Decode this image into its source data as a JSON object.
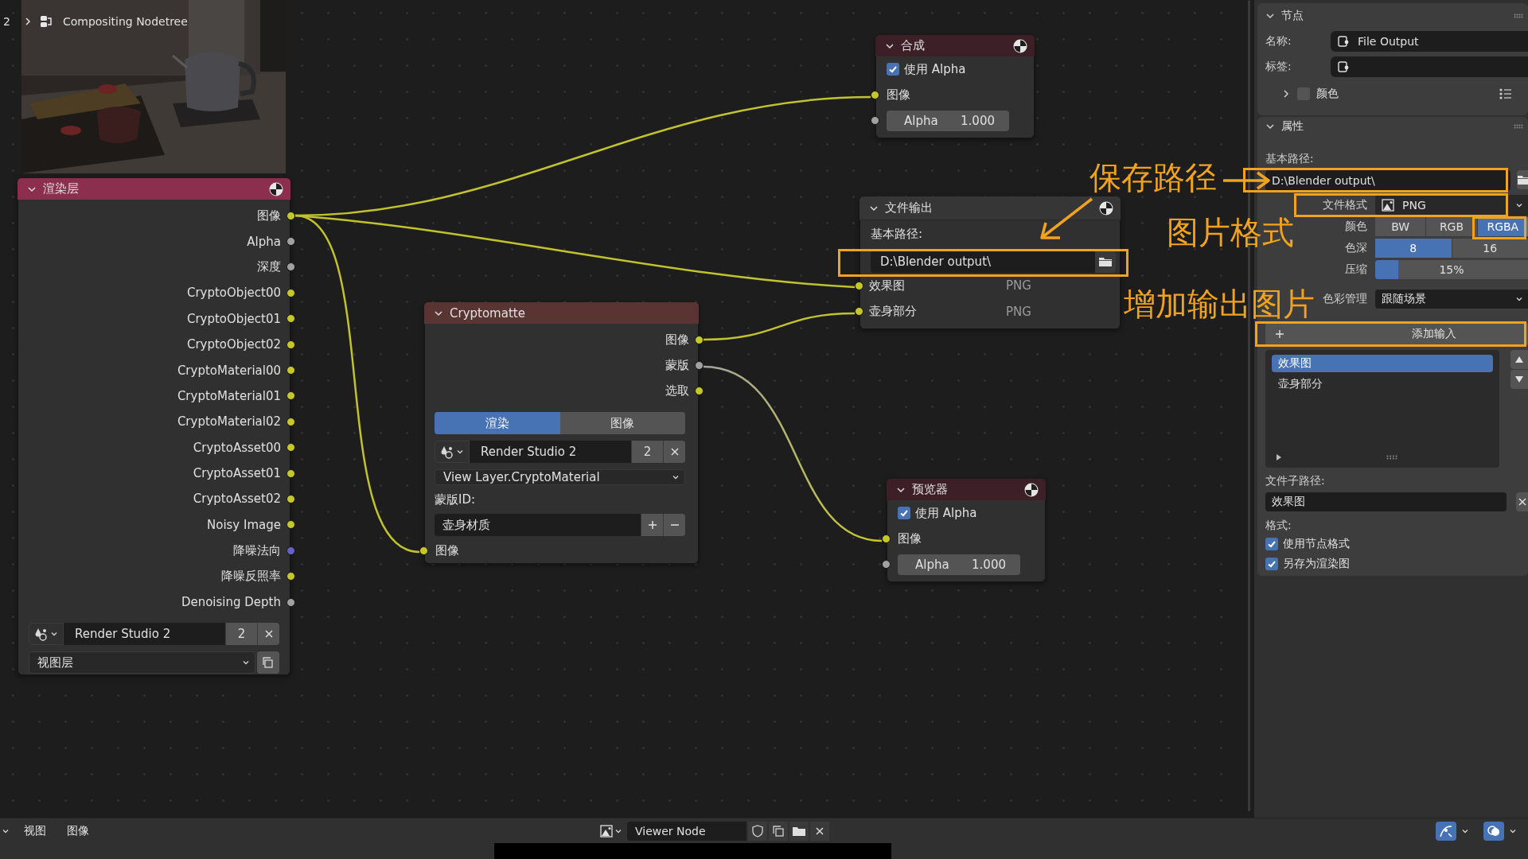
{
  "breadcrumb": {
    "index": "2",
    "title": "Compositing Nodetree"
  },
  "render_layers_node": {
    "title": "渲染层",
    "outputs": [
      {
        "label": "图像",
        "color": "#c7c729"
      },
      {
        "label": "Alpha",
        "color": "#a1a1a1"
      },
      {
        "label": "深度",
        "color": "#a1a1a1"
      },
      {
        "label": "CryptoObject00",
        "color": "#c7c729"
      },
      {
        "label": "CryptoObject01",
        "color": "#c7c729"
      },
      {
        "label": "CryptoObject02",
        "color": "#c7c729"
      },
      {
        "label": "CryptoMaterial00",
        "color": "#c7c729"
      },
      {
        "label": "CryptoMaterial01",
        "color": "#c7c729"
      },
      {
        "label": "CryptoMaterial02",
        "color": "#c7c729"
      },
      {
        "label": "CryptoAsset00",
        "color": "#c7c729"
      },
      {
        "label": "CryptoAsset01",
        "color": "#c7c729"
      },
      {
        "label": "CryptoAsset02",
        "color": "#c7c729"
      },
      {
        "label": "Noisy Image",
        "color": "#c7c729"
      },
      {
        "label": "降噪法向",
        "color": "#6363c7"
      },
      {
        "label": "降噪反照率",
        "color": "#c7c729"
      },
      {
        "label": "Denoising Depth",
        "color": "#a1a1a1"
      }
    ],
    "scene": {
      "name": "Render Studio 2",
      "users": "2"
    },
    "view_layer": "视图层"
  },
  "composite_node": {
    "title": "合成",
    "use_alpha": {
      "label": "使用 Alpha",
      "checked": true
    },
    "inputs": [
      {
        "label": "图像",
        "color": "#c7c729"
      }
    ],
    "alpha": {
      "label": "Alpha",
      "value": "1.000",
      "color": "#a1a1a1"
    }
  },
  "file_output_node": {
    "title": "文件输出",
    "base_path_label": "基本路径:",
    "base_path": "D:\\Blender output\\",
    "inputs": [
      {
        "label": "效果图",
        "format": "PNG",
        "color": "#c7c729"
      },
      {
        "label": "壶身部分",
        "format": "PNG",
        "color": "#c7c729"
      }
    ]
  },
  "cryptomatte_node": {
    "title": "Cryptomatte",
    "outputs": [
      {
        "label": "图像",
        "color": "#c7c729"
      },
      {
        "label": "蒙版",
        "color": "#a1a1a1"
      },
      {
        "label": "选取",
        "color": "#c7c729"
      }
    ],
    "source_tabs": [
      {
        "label": "渲染",
        "selected": true
      },
      {
        "label": "图像",
        "selected": false
      }
    ],
    "scene": {
      "name": "Render Studio 2",
      "users": "2"
    },
    "layer": "View Layer.CryptoMaterial",
    "matte_id_label": "蒙版ID:",
    "matte_id": "壶身材质",
    "inputs": [
      {
        "label": "图像",
        "color": "#c7c729"
      }
    ]
  },
  "viewer_node": {
    "title": "预览器",
    "use_alpha": {
      "label": "使用 Alpha",
      "checked": true
    },
    "inputs": [
      {
        "label": "图像",
        "color": "#c7c729"
      }
    ],
    "alpha": {
      "label": "Alpha",
      "value": "1.000",
      "color": "#a1a1a1"
    }
  },
  "sidebar": {
    "node_panel": {
      "title": "节点",
      "expanded": true,
      "name_label": "名称:",
      "name": "File Output",
      "label_label": "标签:",
      "custom_color": {
        "label": "颜色",
        "checked": false,
        "expanded": false
      }
    },
    "properties_panel": {
      "title": "属性",
      "expanded": true,
      "base_path_label": "基本路径:",
      "base_path": "D:\\Blender output\\",
      "file_format_label": "文件格式",
      "file_format": "PNG",
      "color_label": "颜色",
      "color_modes": [
        {
          "label": "BW",
          "selected": false
        },
        {
          "label": "RGB",
          "selected": false
        },
        {
          "label": "RGBA",
          "selected": true
        }
      ],
      "depth_label": "色深",
      "depths": [
        {
          "label": "8",
          "selected": true
        },
        {
          "label": "16",
          "selected": false
        }
      ],
      "compression_label": "压缩",
      "compression": {
        "value": "15%",
        "level": 0.15
      },
      "color_management_label": "色彩管理",
      "color_management": "跟随场景",
      "add_input": "添加输入",
      "inputs": [
        {
          "label": "效果图",
          "selected": true
        },
        {
          "label": "壶身部分",
          "selected": false
        }
      ],
      "subpath_label": "文件子路径:",
      "subpath": "效果图",
      "format_label": "格式:",
      "options": [
        {
          "label": "使用节点格式",
          "checked": true
        },
        {
          "label": "另存为渲染图",
          "checked": true
        }
      ]
    }
  },
  "annotations": [
    {
      "text": "保存路径"
    },
    {
      "text": "图片格式"
    },
    {
      "text": "增加输出图片"
    }
  ],
  "footer": {
    "menus": [
      "视图",
      "图像"
    ],
    "image_name": "Viewer Node"
  }
}
